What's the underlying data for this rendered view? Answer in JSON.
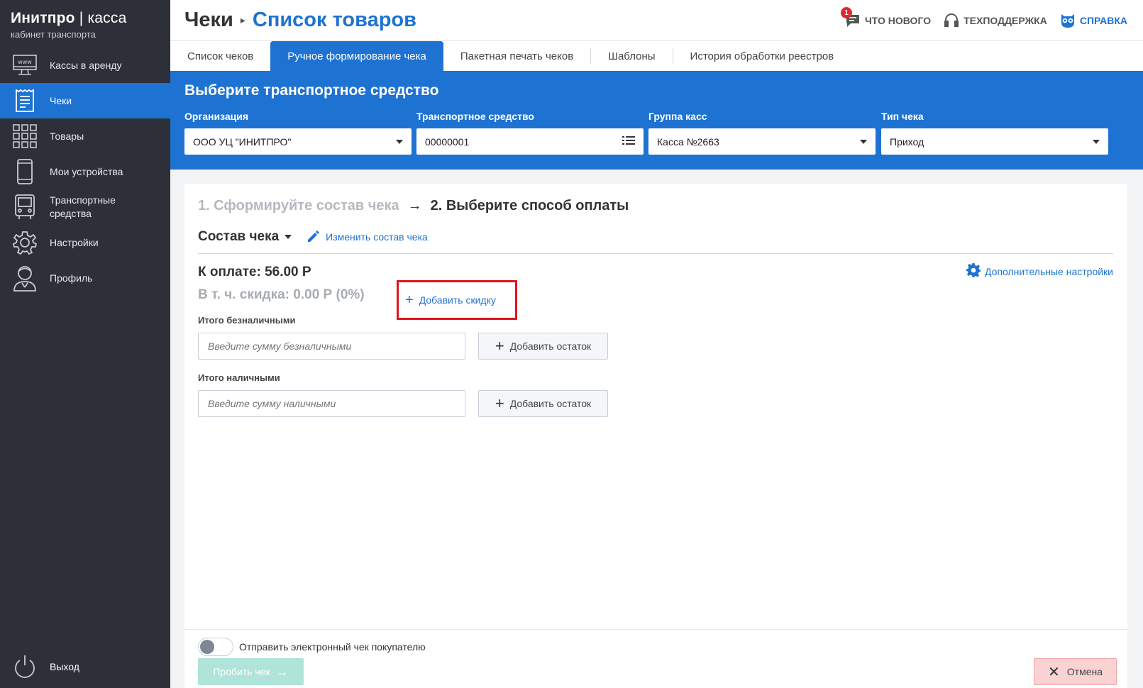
{
  "sidebar": {
    "brand_main": "Инитпро",
    "brand_sep": " | ",
    "brand_second": "касса",
    "brand_sub": "кабинет транспорта",
    "items": [
      {
        "label": "Кассы в аренду",
        "icon": "www-monitor-icon"
      },
      {
        "label": "Чеки",
        "icon": "receipt-icon",
        "active": true
      },
      {
        "label": "Товары",
        "icon": "grid-icon"
      },
      {
        "label": "Мои устройства",
        "icon": "phone-icon"
      },
      {
        "label": "Транспортные средства",
        "icon": "bus-icon"
      },
      {
        "label": "Настройки",
        "icon": "gear-icon"
      },
      {
        "label": "Профиль",
        "icon": "user-icon"
      }
    ],
    "logout": "Выход"
  },
  "header": {
    "root": "Чеки",
    "current": "Список товаров",
    "links": {
      "news": "ЧТО НОВОГО",
      "news_badge": "1",
      "support": "ТЕХПОДДЕРЖКА",
      "help": "СПРАВКА"
    }
  },
  "tabs": [
    {
      "label": "Список чеков"
    },
    {
      "label": "Ручное формирование чека",
      "active": true
    },
    {
      "label": "Пакетная печать чеков"
    },
    {
      "label": "Шаблоны"
    },
    {
      "label": "История обработки реестров"
    }
  ],
  "vehicle_panel": {
    "title": "Выберите транспортное средство",
    "org_label": "Организация",
    "org_value": "ООО УЦ \"ИНИТПРО\"",
    "vehicle_label": "Транспортное средство",
    "vehicle_value": "00000001",
    "group_label": "Группа касс",
    "group_value": "Касса №2663",
    "type_label": "Тип чека",
    "type_value": "Приход"
  },
  "main": {
    "step1": "1. Сформируйте состав чека",
    "step_arrow": "→",
    "step2": "2. Выберите способ оплаты",
    "compose_title": "Состав чека",
    "edit_link": "Изменить состав чека",
    "to_pay": "К оплате: 56.00 Р",
    "discount": "В т. ч. скидка: 0.00 Р (0%)",
    "add_discount": "Добавить скидку",
    "adv_settings": "Дополнительные настройки",
    "cashless_label": "Итого безналичными",
    "cashless_placeholder": "Введите сумму безналичными",
    "cash_label": "Итого наличными",
    "cash_placeholder": "Введите сумму наличными",
    "add_rest": "Добавить остаток",
    "send_email": "Отправить электронный чек покупателю",
    "submit": "Пробить чек",
    "cancel": "Отмена"
  },
  "colors": {
    "sidebar_bg": "#2d3039",
    "accent": "#1e73d2",
    "highlight_border": "#e0141e",
    "submit_bg": "#aee4da",
    "cancel_bg": "#fad2d2"
  }
}
